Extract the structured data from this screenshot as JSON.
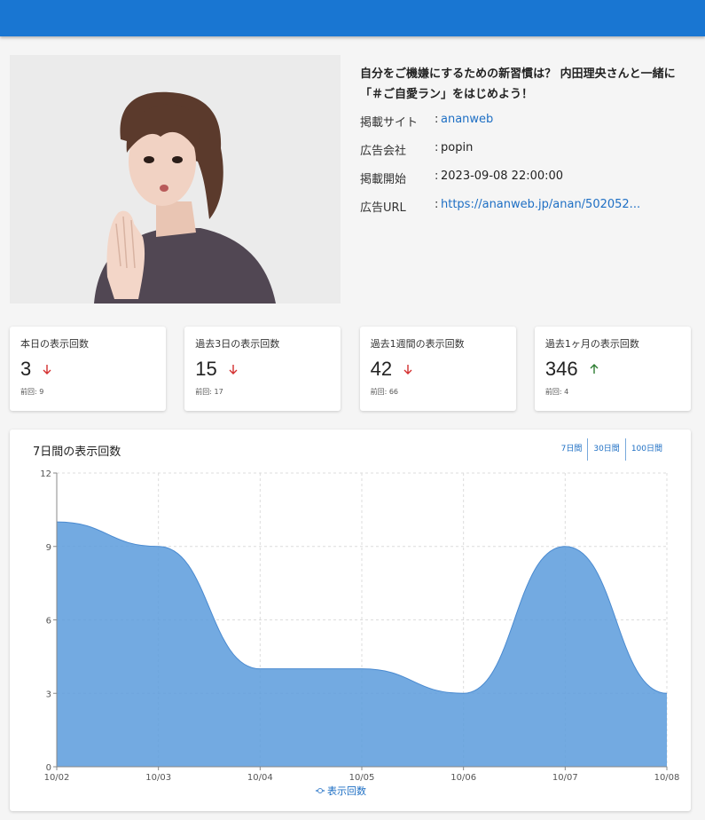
{
  "article": {
    "title": "自分をご機嫌にするための新習慣は？ 内田理央さんと一緒に「＃ご自愛ラン」をはじめよう！",
    "rows": [
      {
        "key": "掲載サイト",
        "value": "ananweb",
        "link": true
      },
      {
        "key": "広告会社",
        "value": "popin",
        "link": false
      },
      {
        "key": "掲載開始",
        "value": "2023-09-08 22:00:00",
        "link": false
      },
      {
        "key": "広告URL",
        "value": "https://ananweb.jp/anan/502052...",
        "link": true
      }
    ]
  },
  "stats": [
    {
      "label": "本日の表示回数",
      "value": "3",
      "trend": "down",
      "prev": "前回: 9"
    },
    {
      "label": "過去3日の表示回数",
      "value": "15",
      "trend": "down",
      "prev": "前回: 17"
    },
    {
      "label": "過去1週間の表示回数",
      "value": "42",
      "trend": "down",
      "prev": "前回: 66"
    },
    {
      "label": "過去1ヶ月の表示回数",
      "value": "346",
      "trend": "up",
      "prev": "前回: 4"
    }
  ],
  "colors": {
    "accent": "#1976d2",
    "down": "#d32f2f",
    "up": "#2e7d32",
    "area": "#5b9bdc"
  },
  "chart": {
    "title": "7日間の表示回数",
    "ranges": [
      "7日間",
      "30日間",
      "100日間"
    ]
  },
  "chart_data": {
    "type": "area",
    "categories": [
      "10/02",
      "10/03",
      "10/04",
      "10/05",
      "10/06",
      "10/07",
      "10/08"
    ],
    "series": [
      {
        "name": "表示回数",
        "values": [
          10,
          9,
          4,
          4,
          3,
          9,
          3
        ]
      }
    ],
    "ylim": [
      0,
      12
    ],
    "yticks": [
      0,
      3,
      6,
      9,
      12
    ],
    "grid": true,
    "legend": "bottom"
  }
}
